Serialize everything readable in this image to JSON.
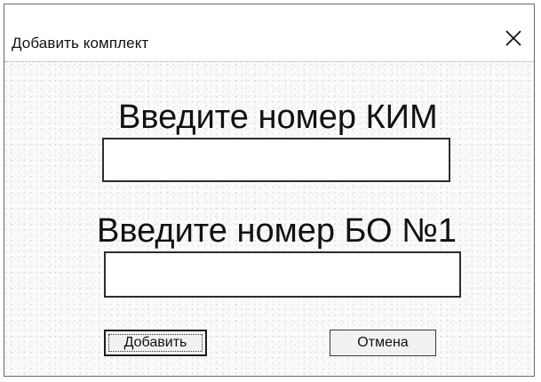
{
  "window": {
    "title": "Добавить комплект",
    "close_glyph": "✕"
  },
  "form": {
    "prompt_kim": "Введите номер КИМ",
    "kim_value": "",
    "prompt_bo": "Введите номер БО №1",
    "bo_value": ""
  },
  "buttons": {
    "add_label": "Добавить",
    "cancel_label": "Отмена"
  },
  "icons": {
    "close": "close-icon"
  },
  "colors": {
    "border": "#2d2d2d",
    "background": "#fbfbfb"
  }
}
